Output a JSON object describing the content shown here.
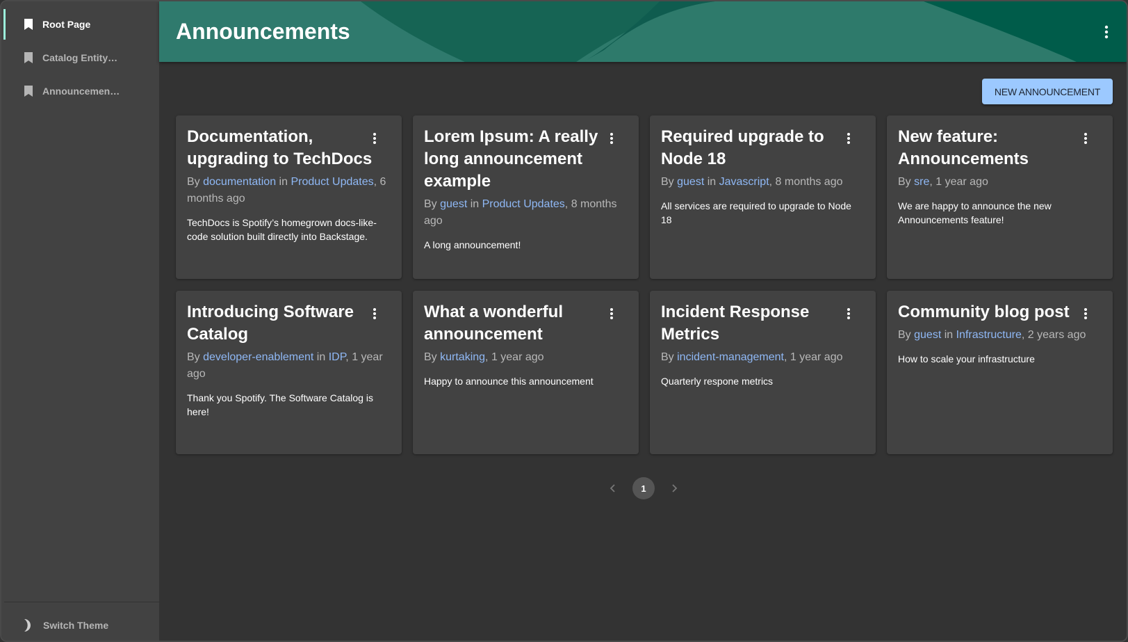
{
  "sidebar": {
    "items": [
      {
        "label": "Root Page",
        "icon": "bookmark-icon",
        "active": true
      },
      {
        "label": "Catalog Entity…",
        "icon": "bookmark-icon",
        "active": false
      },
      {
        "label": "Announcemen…",
        "icon": "bookmark-icon",
        "active": false
      }
    ],
    "switch_theme": {
      "label": "Switch Theme",
      "icon": "moon-icon"
    }
  },
  "header": {
    "title": "Announcements",
    "menu_icon": "more-vertical-icon"
  },
  "toolbar": {
    "new_announcement_label": "NEW ANNOUNCEMENT"
  },
  "colors": {
    "header_bg": "#115e52",
    "accent_button": "#9cc9ff",
    "link": "#8fb8f5",
    "active_indicator": "#9cf0dc",
    "card_bg": "#424242",
    "page_bg": "#333333"
  },
  "announcements": [
    {
      "title": "Documentation, upgrading to TechDocs",
      "by_prefix": "By ",
      "author": "documentation",
      "in_text": " in ",
      "category": "Product Updates",
      "time": ", 6 months ago",
      "body": "TechDocs is Spotify’s homegrown docs-like-code solution built directly into Backstage."
    },
    {
      "title": "Lorem Ipsum: A really long announcement example",
      "by_prefix": "By ",
      "author": "guest",
      "in_text": " in ",
      "category": "Product Updates",
      "time": ", 8 months ago",
      "body": "A long announcement!"
    },
    {
      "title": "Required upgrade to Node 18",
      "by_prefix": "By ",
      "author": "guest",
      "in_text": " in ",
      "category": "Javascript",
      "time": ", 8 months ago",
      "body": "All services are required to upgrade to Node 18"
    },
    {
      "title": "New feature: Announcements",
      "by_prefix": "By ",
      "author": "sre",
      "in_text": "",
      "category": "",
      "time": ", 1 year ago",
      "body": "We are happy to announce the new Announcements feature!"
    },
    {
      "title": "Introducing Software Catalog",
      "by_prefix": "By ",
      "author": "developer-enablement",
      "in_text": " in ",
      "category": "IDP",
      "time": ", 1 year ago",
      "body": "Thank you Spotify. The Software Catalog is here!"
    },
    {
      "title": "What a wonderful announcement",
      "by_prefix": "By ",
      "author": "kurtaking",
      "in_text": "",
      "category": "",
      "time": ", 1 year ago",
      "body": "Happy to announce this announcement"
    },
    {
      "title": "Incident Response Metrics",
      "by_prefix": "By ",
      "author": "incident-management",
      "in_text": "",
      "category": "",
      "time": ", 1 year ago",
      "body": "Quarterly respone metrics"
    },
    {
      "title": "Community blog post",
      "by_prefix": "By ",
      "author": "guest",
      "in_text": " in ",
      "category": "Infrastructure",
      "time": ", 2 years ago",
      "body": "How to scale your infrastructure"
    }
  ],
  "pagination": {
    "current_page": "1",
    "prev_icon": "chevron-left-icon",
    "next_icon": "chevron-right-icon"
  }
}
